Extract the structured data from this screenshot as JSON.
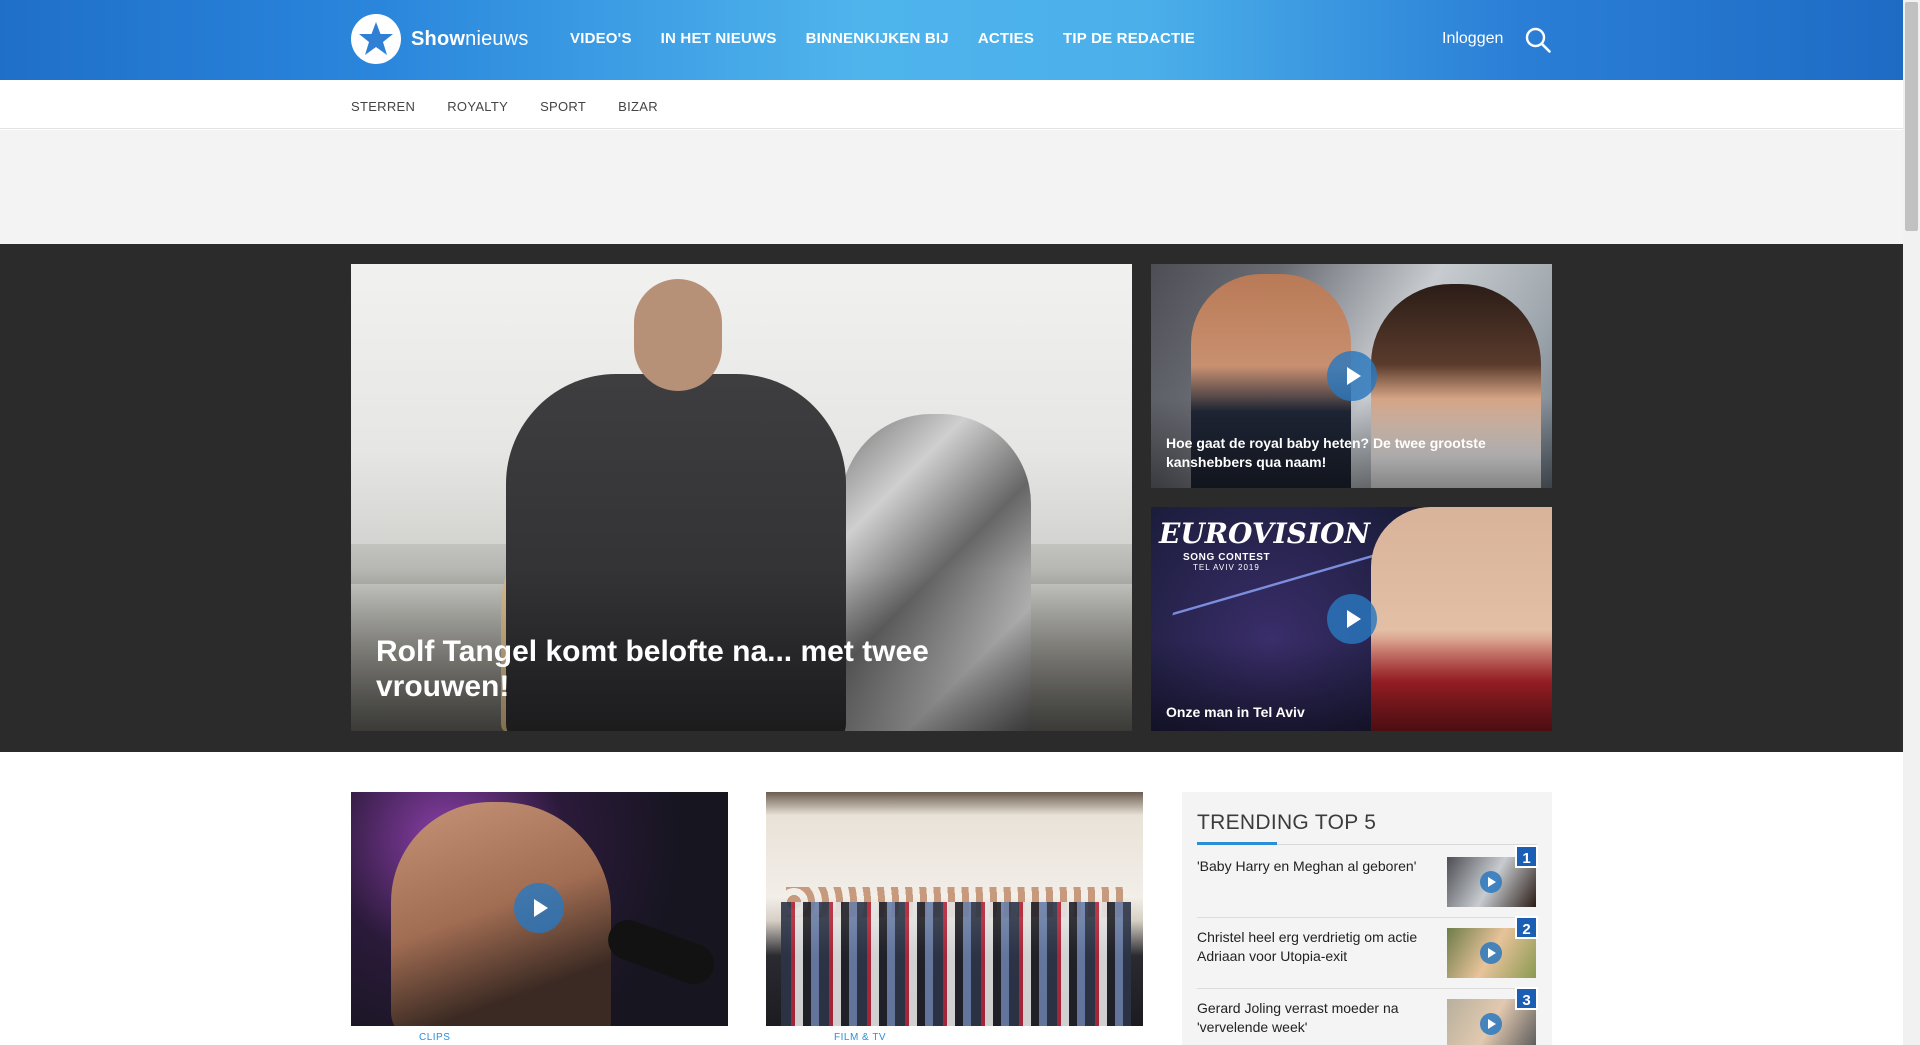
{
  "header": {
    "logo_bold": "Show",
    "logo_light": "nieuws",
    "nav": [
      "VIDEO'S",
      "IN HET NIEUWS",
      "BINNENKIJKEN BIJ",
      "ACTIES",
      "TIP DE REDACTIE"
    ],
    "login_label": "Inloggen",
    "search_icon": "search-icon"
  },
  "subnav": [
    "STERREN",
    "ROYALTY",
    "SPORT",
    "BIZAR"
  ],
  "hero": {
    "main_title": "Rolf Tangel komt belofte na... met twee vrouwen!",
    "side": [
      {
        "title": "Hoe gaat de royal baby heten? De twee grootste kanshebbers qua naam!"
      },
      {
        "title": "Onze man in Tel Aviv"
      }
    ],
    "eurovision_logo": {
      "line1": "EUROVISION",
      "line2": "SONG CONTEST",
      "line3": "TEL AVIV 2019"
    }
  },
  "cards": [
    {
      "category": "CLIPS"
    },
    {
      "category": "FILM & TV"
    }
  ],
  "trending": {
    "title": "TRENDING TOP 5",
    "items": [
      {
        "rank": "1",
        "text": "'Baby Harry en Meghan al geboren'"
      },
      {
        "rank": "2",
        "text": "Christel heel erg verdrietig om actie Adriaan voor Utopia-exit"
      },
      {
        "rank": "3",
        "text": "Gerard Joling verrast moeder na 'vervelende week'"
      }
    ]
  },
  "colors": {
    "header_blue": "#2a86dc",
    "accent": "#2b8fd8",
    "hero_bg": "#2b2b2b",
    "rank_badge": "#1b5fb5"
  }
}
